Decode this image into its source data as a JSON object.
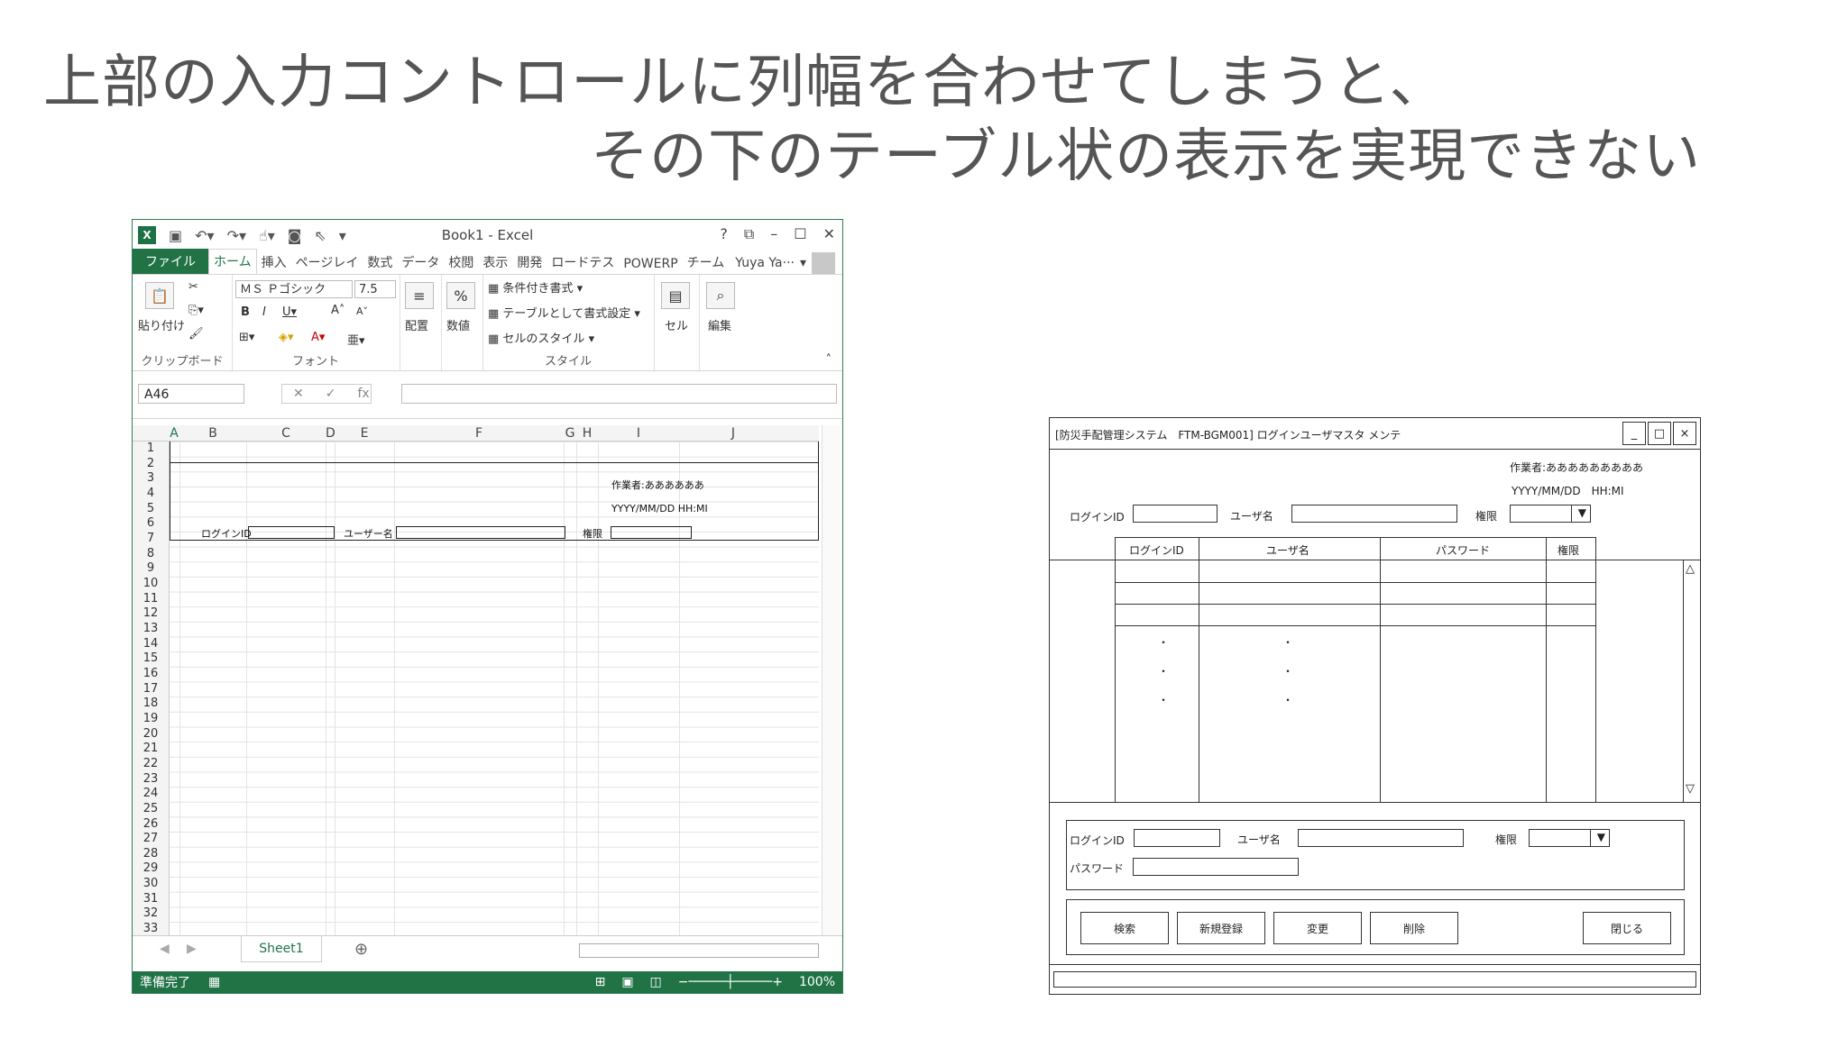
{
  "slide": {
    "title_line1": "上部の入力コントロールに列幅を合わせてしまうと、",
    "title_line2": "その下のテーブル状の表示を実現できない"
  },
  "excel": {
    "window_title": "Book1 - Excel",
    "tabs": [
      "ファイル",
      "ホーム",
      "挿入",
      "ページレイ",
      "数式",
      "データ",
      "校閲",
      "表示",
      "開発",
      "ロードテス",
      "POWERP",
      "チーム"
    ],
    "active_tab": "ホーム",
    "user": "Yuya Ya···",
    "ribbon": {
      "paste": "貼り付け",
      "font_name": "ＭＳ Ｐゴシック",
      "font_size": "7.5",
      "align": "配置",
      "number": "数値",
      "cond_format": "条件付き書式",
      "table_format": "テーブルとして書式設定",
      "cell_style": "セルのスタイル",
      "cell": "セル",
      "edit": "編集",
      "group_clipboard": "クリップボード",
      "group_font": "フォント",
      "group_style": "スタイル"
    },
    "name_box": "A46",
    "col_headers": [
      "A",
      "B",
      "C",
      "D",
      "E",
      "F",
      "G",
      "H",
      "I",
      "J"
    ],
    "row_numbers": [
      "1",
      "2",
      "3",
      "4",
      "5",
      "6",
      "7",
      "8",
      "9",
      "10",
      "11",
      "12",
      "13",
      "14",
      "15",
      "16",
      "17",
      "18",
      "19",
      "20",
      "21",
      "22",
      "23",
      "24",
      "25",
      "26",
      "27",
      "28",
      "29",
      "30",
      "31",
      "32",
      "33"
    ],
    "cells": {
      "author": "作業者:ああああああ",
      "datetime": "YYYY/MM/DD HH:MI",
      "login_id": "ログインID",
      "user_name": "ユーザー名",
      "permission": "権限"
    },
    "sheet_tab": "Sheet1",
    "status_text": "準備完了",
    "zoom": "100%"
  },
  "dialog": {
    "title": "[防災手配管理システム　FTM-BGM001] ログインユーザマスタ メンテ",
    "author": "作業者:あああああああああ",
    "datetime": "YYYY/MM/DD　HH:MI",
    "filter": {
      "login_id": "ログインID",
      "user_name": "ユーザ名",
      "permission": "権限"
    },
    "table_headers": [
      "ログインID",
      "ユーザ名",
      "パスワード",
      "権限"
    ],
    "ellipsis": "・",
    "edit": {
      "login_id": "ログインID",
      "user_name": "ユーザ名",
      "permission": "権限",
      "password": "パスワード"
    },
    "buttons": {
      "search": "検索",
      "new": "新規登録",
      "change": "変更",
      "delete": "削除",
      "close": "閉じる"
    }
  }
}
